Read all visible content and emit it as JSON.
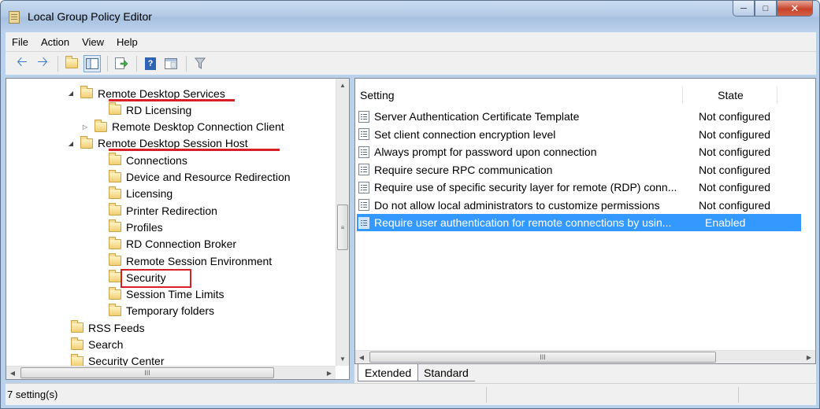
{
  "window": {
    "title": "Local Group Policy Editor"
  },
  "menu": [
    "File",
    "Action",
    "View",
    "Help"
  ],
  "tree": [
    {
      "label": "Remote Desktop Services",
      "expander": "◢",
      "marked": "underline"
    },
    {
      "label": "RD Licensing",
      "expander": "",
      "marked": ""
    },
    {
      "label": "Remote Desktop Connection Client",
      "expander": "▷",
      "marked": ""
    },
    {
      "label": "Remote Desktop Session Host",
      "expander": "◢",
      "marked": "underline"
    },
    {
      "label": "Connections",
      "expander": "",
      "marked": ""
    },
    {
      "label": "Device and Resource Redirection",
      "expander": "",
      "marked": ""
    },
    {
      "label": "Licensing",
      "expander": "",
      "marked": ""
    },
    {
      "label": "Printer Redirection",
      "expander": "",
      "marked": ""
    },
    {
      "label": "Profiles",
      "expander": "",
      "marked": ""
    },
    {
      "label": "RD Connection Broker",
      "expander": "",
      "marked": ""
    },
    {
      "label": "Remote Session Environment",
      "expander": "",
      "marked": ""
    },
    {
      "label": "Security",
      "expander": "",
      "marked": "box"
    },
    {
      "label": "Session Time Limits",
      "expander": "",
      "marked": ""
    },
    {
      "label": "Temporary folders",
      "expander": "",
      "marked": ""
    },
    {
      "label": "RSS Feeds",
      "expander": "",
      "marked": ""
    },
    {
      "label": "Search",
      "expander": "",
      "marked": ""
    },
    {
      "label": "Security Center",
      "expander": "",
      "marked": ""
    }
  ],
  "list": {
    "columns": {
      "setting": "Setting",
      "state": "State"
    },
    "rows": [
      {
        "setting": "Server Authentication Certificate Template",
        "state": "Not configured",
        "selected": false
      },
      {
        "setting": "Set client connection encryption level",
        "state": "Not configured",
        "selected": false
      },
      {
        "setting": "Always prompt for password upon connection",
        "state": "Not configured",
        "selected": false
      },
      {
        "setting": "Require secure RPC communication",
        "state": "Not configured",
        "selected": false
      },
      {
        "setting": "Require use of specific security layer for remote (RDP) conn...",
        "state": "Not configured",
        "selected": false
      },
      {
        "setting": "Do not allow local administrators to customize permissions",
        "state": "Not configured",
        "selected": false
      },
      {
        "setting": "Require user authentication for remote connections by usin...",
        "state": "Enabled",
        "selected": true
      }
    ]
  },
  "tabs": {
    "extended": "Extended",
    "standard": "Standard"
  },
  "status": {
    "text": "7 setting(s)"
  },
  "scroll": {
    "thumb_grip": "≡",
    "hthumb_grip": "III"
  },
  "colors": {
    "selection": "#3399ff",
    "highlight_marker": "#d61f26"
  }
}
